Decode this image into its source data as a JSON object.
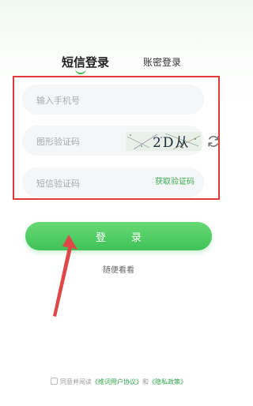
{
  "tabs": {
    "sms_login": "短信登录",
    "password_login": "账密登录"
  },
  "form": {
    "phone_placeholder": "输入手机号",
    "captcha_placeholder": "图形验证码",
    "captcha_text": "2D从",
    "sms_code_placeholder": "短信验证码",
    "get_code_label": "获取验证码"
  },
  "login_button": "登 录",
  "browse_link": "随便看看",
  "agreement": {
    "prefix": "同意并阅读",
    "user_agreement": "《维词用户协议》",
    "and": "和",
    "privacy_policy": "《隐私政策》"
  },
  "colors": {
    "accent": "#3fc257",
    "highlight_box": "#e23a3a",
    "annotation_arrow": "#e04848"
  },
  "icons": [
    "refresh-icon",
    "checkbox-icon",
    "annotation-arrow"
  ]
}
